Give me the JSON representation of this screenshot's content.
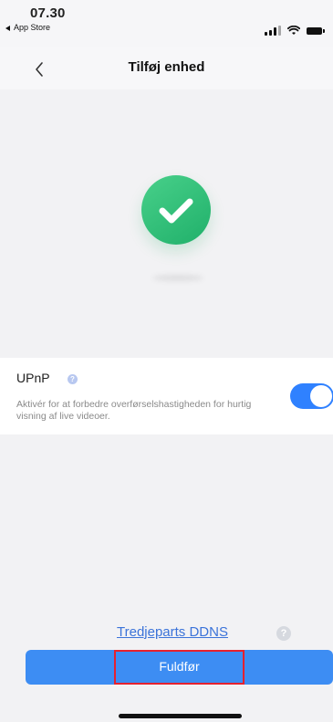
{
  "status_bar": {
    "time": "07.30",
    "back_app": "App Store"
  },
  "nav": {
    "title": "Tilføj enhed"
  },
  "icons": {
    "back": "chevron-left-icon",
    "success": "check-icon",
    "help": "question-icon",
    "signal": "signal-icon",
    "wifi": "wifi-icon",
    "battery": "battery-icon"
  },
  "upnp": {
    "label": "UPnP",
    "description": "Aktivér for at forbedre overførselshastigheden for hurtig visning af live videoer.",
    "enabled": true
  },
  "footer": {
    "ddns_link": "Tredjeparts DDNS",
    "finish_button": "Fuldfør"
  },
  "colors": {
    "accent": "#3d8df3",
    "success": "#2fc77a",
    "link": "#3b73d9",
    "highlight": "#e6212f"
  }
}
